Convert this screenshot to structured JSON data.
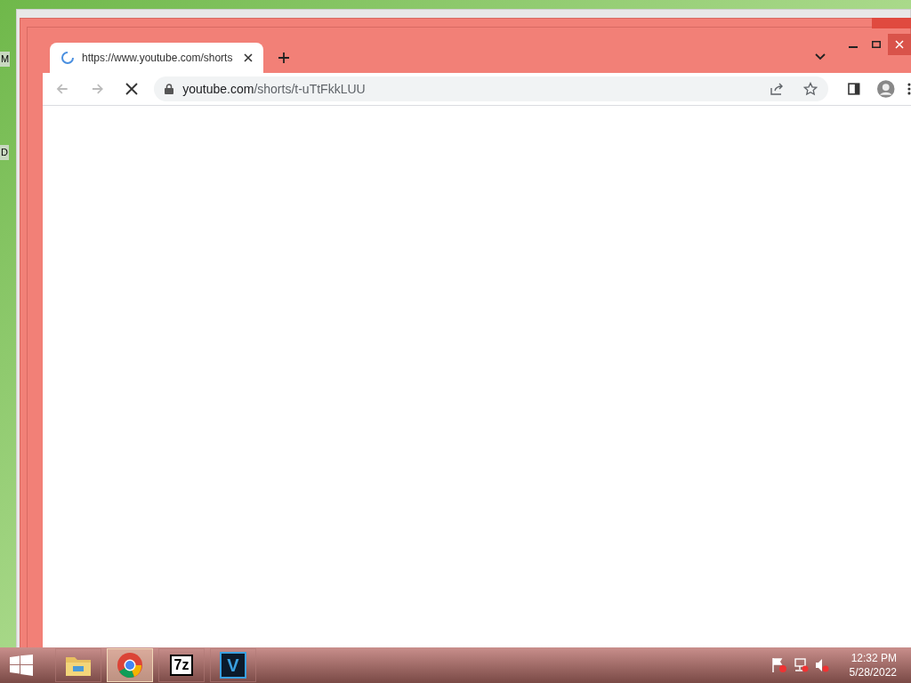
{
  "desktop_labels": [
    "M",
    "D"
  ],
  "browser": {
    "tabs": [
      {
        "title": "https://www.youtube.com/shorts",
        "selected": true,
        "loading": true
      }
    ],
    "address": {
      "host": "youtube.com",
      "path": "/shorts/t-uTtFkkLUU"
    },
    "page_loading": true
  },
  "taskbar": {
    "apps": [
      {
        "kind": "explorer",
        "selected": false
      },
      {
        "kind": "chrome",
        "selected": true
      },
      {
        "kind": "archiver",
        "label": "7z",
        "selected": false
      },
      {
        "kind": "vegas",
        "label": "V",
        "selected": false
      }
    ],
    "time": "12:32 PM",
    "date": "5/28/2022"
  }
}
